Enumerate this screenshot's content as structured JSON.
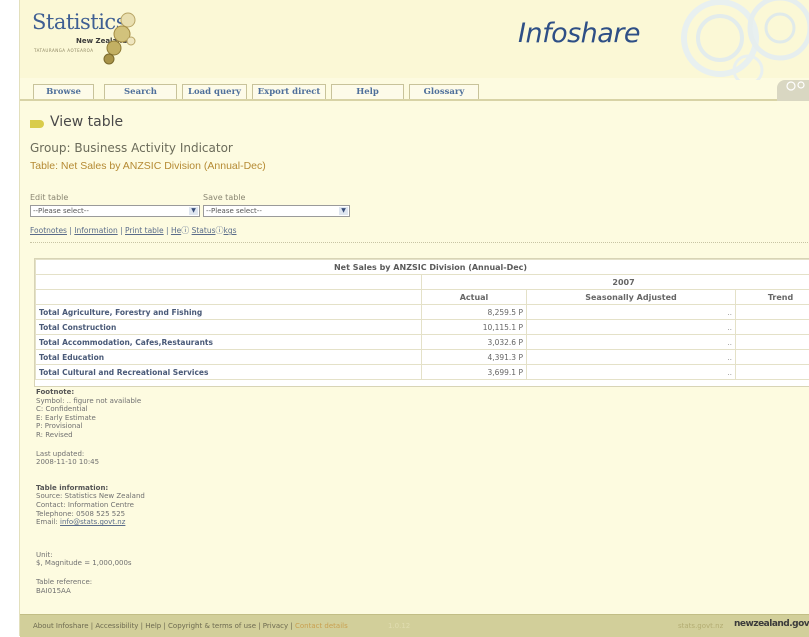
{
  "header": {
    "logo_text": "Statistics",
    "logo_sub": "New Zealand",
    "logo_maori": "TATAURANGA AOTEAROA",
    "app_title": "Infoshare"
  },
  "nav": {
    "items": [
      {
        "label": "Browse"
      },
      {
        "label": "Search"
      },
      {
        "label": "Load query"
      },
      {
        "label": "Export direct"
      },
      {
        "label": "Help"
      },
      {
        "label": "Glossary"
      }
    ]
  },
  "page": {
    "heading": "View table",
    "group": "Group:  Business Activity Indicator",
    "table_title": "Table: Net Sales by ANZSIC Division (Annual-Dec)"
  },
  "controls": {
    "edit_label": "Edit table",
    "edit_value": "--Please select--",
    "save_label": "Save table",
    "save_value": "--Please select--"
  },
  "links": {
    "footnotes": "Footnotes",
    "information": "Information",
    "print": "Print table",
    "help": "He",
    "status": "Status",
    "status_tail": "kgs",
    "sep": " | "
  },
  "table": {
    "caption": "Net Sales by ANZSIC Division (Annual-Dec)",
    "year": "2007",
    "columns": [
      "Actual",
      "Seasonally Adjusted",
      "Trend"
    ],
    "rows": [
      {
        "label": "Total Agriculture, Forestry and Fishing",
        "actual": "8,259.5 P",
        "sa": "..",
        "trend": ".."
      },
      {
        "label": "Total Construction",
        "actual": "10,115.1 P",
        "sa": "..",
        "trend": ".."
      },
      {
        "label": "Total Accommodation, Cafes,Restaurants",
        "actual": "3,032.6 P",
        "sa": "..",
        "trend": ".."
      },
      {
        "label": "Total Education",
        "actual": "4,391.3 P",
        "sa": "..",
        "trend": ".."
      },
      {
        "label": "Total Cultural and Recreational Services",
        "actual": "3,699.1 P",
        "sa": "..",
        "trend": ".."
      }
    ]
  },
  "footnotes": {
    "heading": "Footnote:",
    "lines": [
      "Symbol: .. figure not available",
      "C: Confidential",
      "E: Early Estimate",
      "P: Provisional",
      "R: Revised"
    ],
    "updated_label": "Last updated:",
    "updated_value": "2008-11-10 10:45",
    "info_heading": "Table information:",
    "info_lines": [
      "Source: Statistics New Zealand",
      "Contact: Information Centre",
      "Telephone: 0508 525 525"
    ],
    "email_label": "Email: ",
    "email_value": "info@stats.govt.nz",
    "unit_label": "Unit:",
    "unit_value": "$, Magnitude = 1,000,000s",
    "ref_label": "Table reference:",
    "ref_value": "BAI015AA"
  },
  "footer": {
    "links": "About Infoshare | Accessibility | Help | Copyright & terms of use | Privacy | ",
    "contact": "Contact details",
    "version": "1.0.12",
    "stats_link": "stats.govt.nz",
    "nz_logo": "newzealand.govt.nz"
  }
}
